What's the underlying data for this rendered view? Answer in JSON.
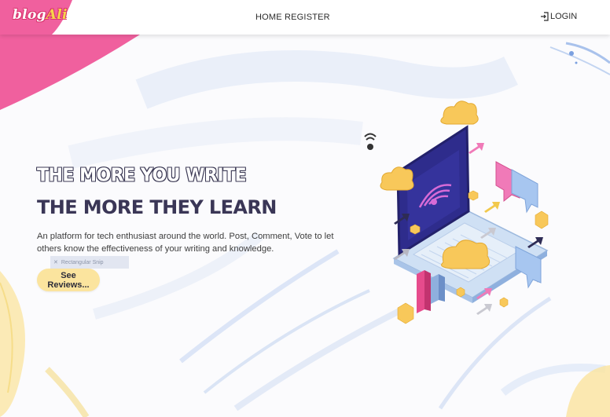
{
  "navbar": {
    "logo_part1": "blog",
    "logo_part2": "Ali",
    "links": [
      {
        "label": "HOME"
      },
      {
        "label": "REGISTER"
      }
    ],
    "login_label": "LOGIN",
    "login_icon": "login-icon"
  },
  "hero": {
    "headline_line1": "THE MORE YOU WRITE",
    "headline_line2": "THE MORE THEY LEARN",
    "description": "An platform for tech enthusiast around the world. Post, Comment, Vote to let others know the effectiveness of your writing and knowledge.",
    "button_label": "See Reviews...",
    "tooltip_text": "Rectangular Snip"
  },
  "colors": {
    "brand_pink": "#f0609e",
    "accent_yellow": "#fbe49e",
    "headline": "#3a3656",
    "laptop_screen": "#2e2c8c"
  }
}
